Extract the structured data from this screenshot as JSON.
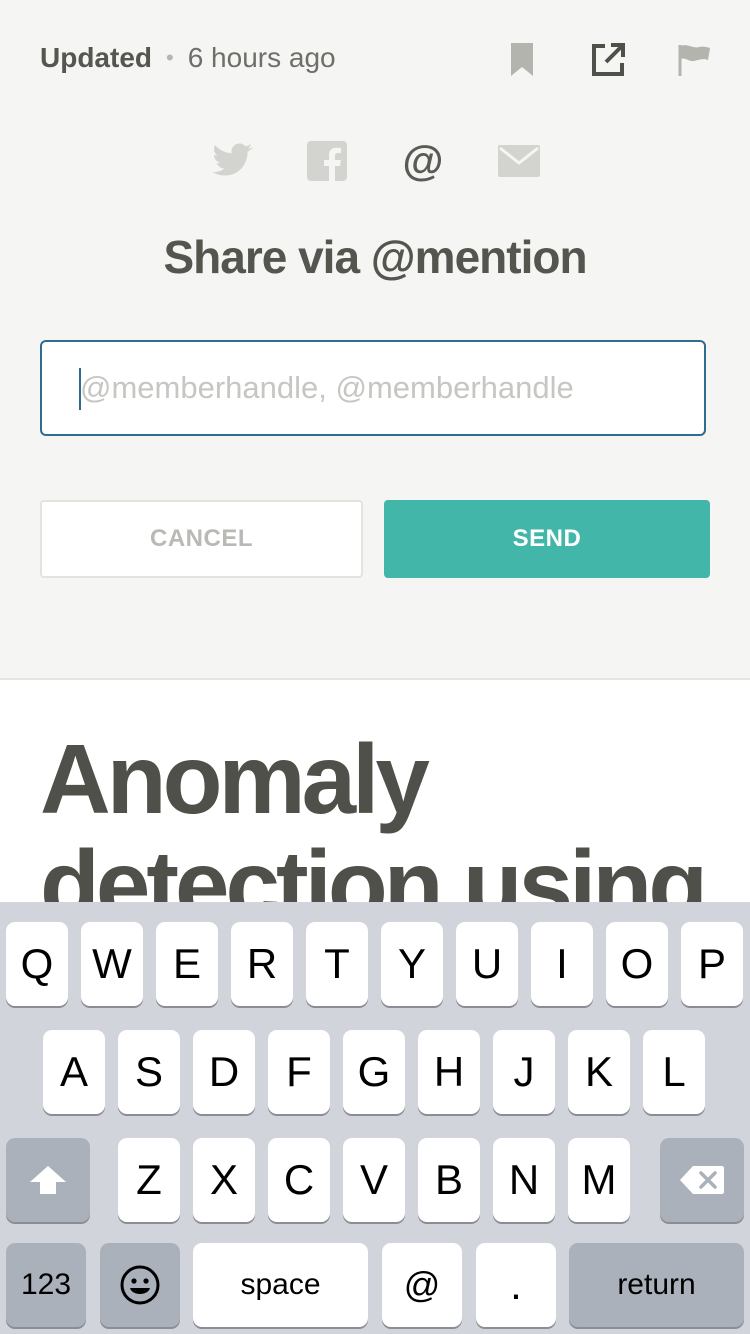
{
  "meta": {
    "updated_label": "Updated",
    "separator": "•",
    "time": "6 hours ago",
    "icons": [
      "bookmark-icon",
      "external-link-icon",
      "flag-icon"
    ]
  },
  "share": {
    "icons": [
      "twitter-icon",
      "facebook-icon",
      "at-mention-icon",
      "email-icon"
    ],
    "at_symbol": "@",
    "title": "Share via @mention",
    "input_placeholder": "@memberhandle, @memberhandle",
    "input_value": "",
    "cancel_label": "CANCEL",
    "send_label": "SEND"
  },
  "article": {
    "title": "Anomaly detection using"
  },
  "keyboard": {
    "row1": [
      "Q",
      "W",
      "E",
      "R",
      "T",
      "Y",
      "U",
      "I",
      "O",
      "P"
    ],
    "row2": [
      "A",
      "S",
      "D",
      "F",
      "G",
      "H",
      "J",
      "K",
      "L"
    ],
    "row3": [
      "Z",
      "X",
      "C",
      "V",
      "B",
      "N",
      "M"
    ],
    "numbers_label": "123",
    "space_label": "space",
    "at_label": "@",
    "period_label": ".",
    "return_label": "return"
  },
  "colors": {
    "accent": "#42b6a8",
    "input_border": "#2e6d8f",
    "text_dark": "#54554f"
  }
}
